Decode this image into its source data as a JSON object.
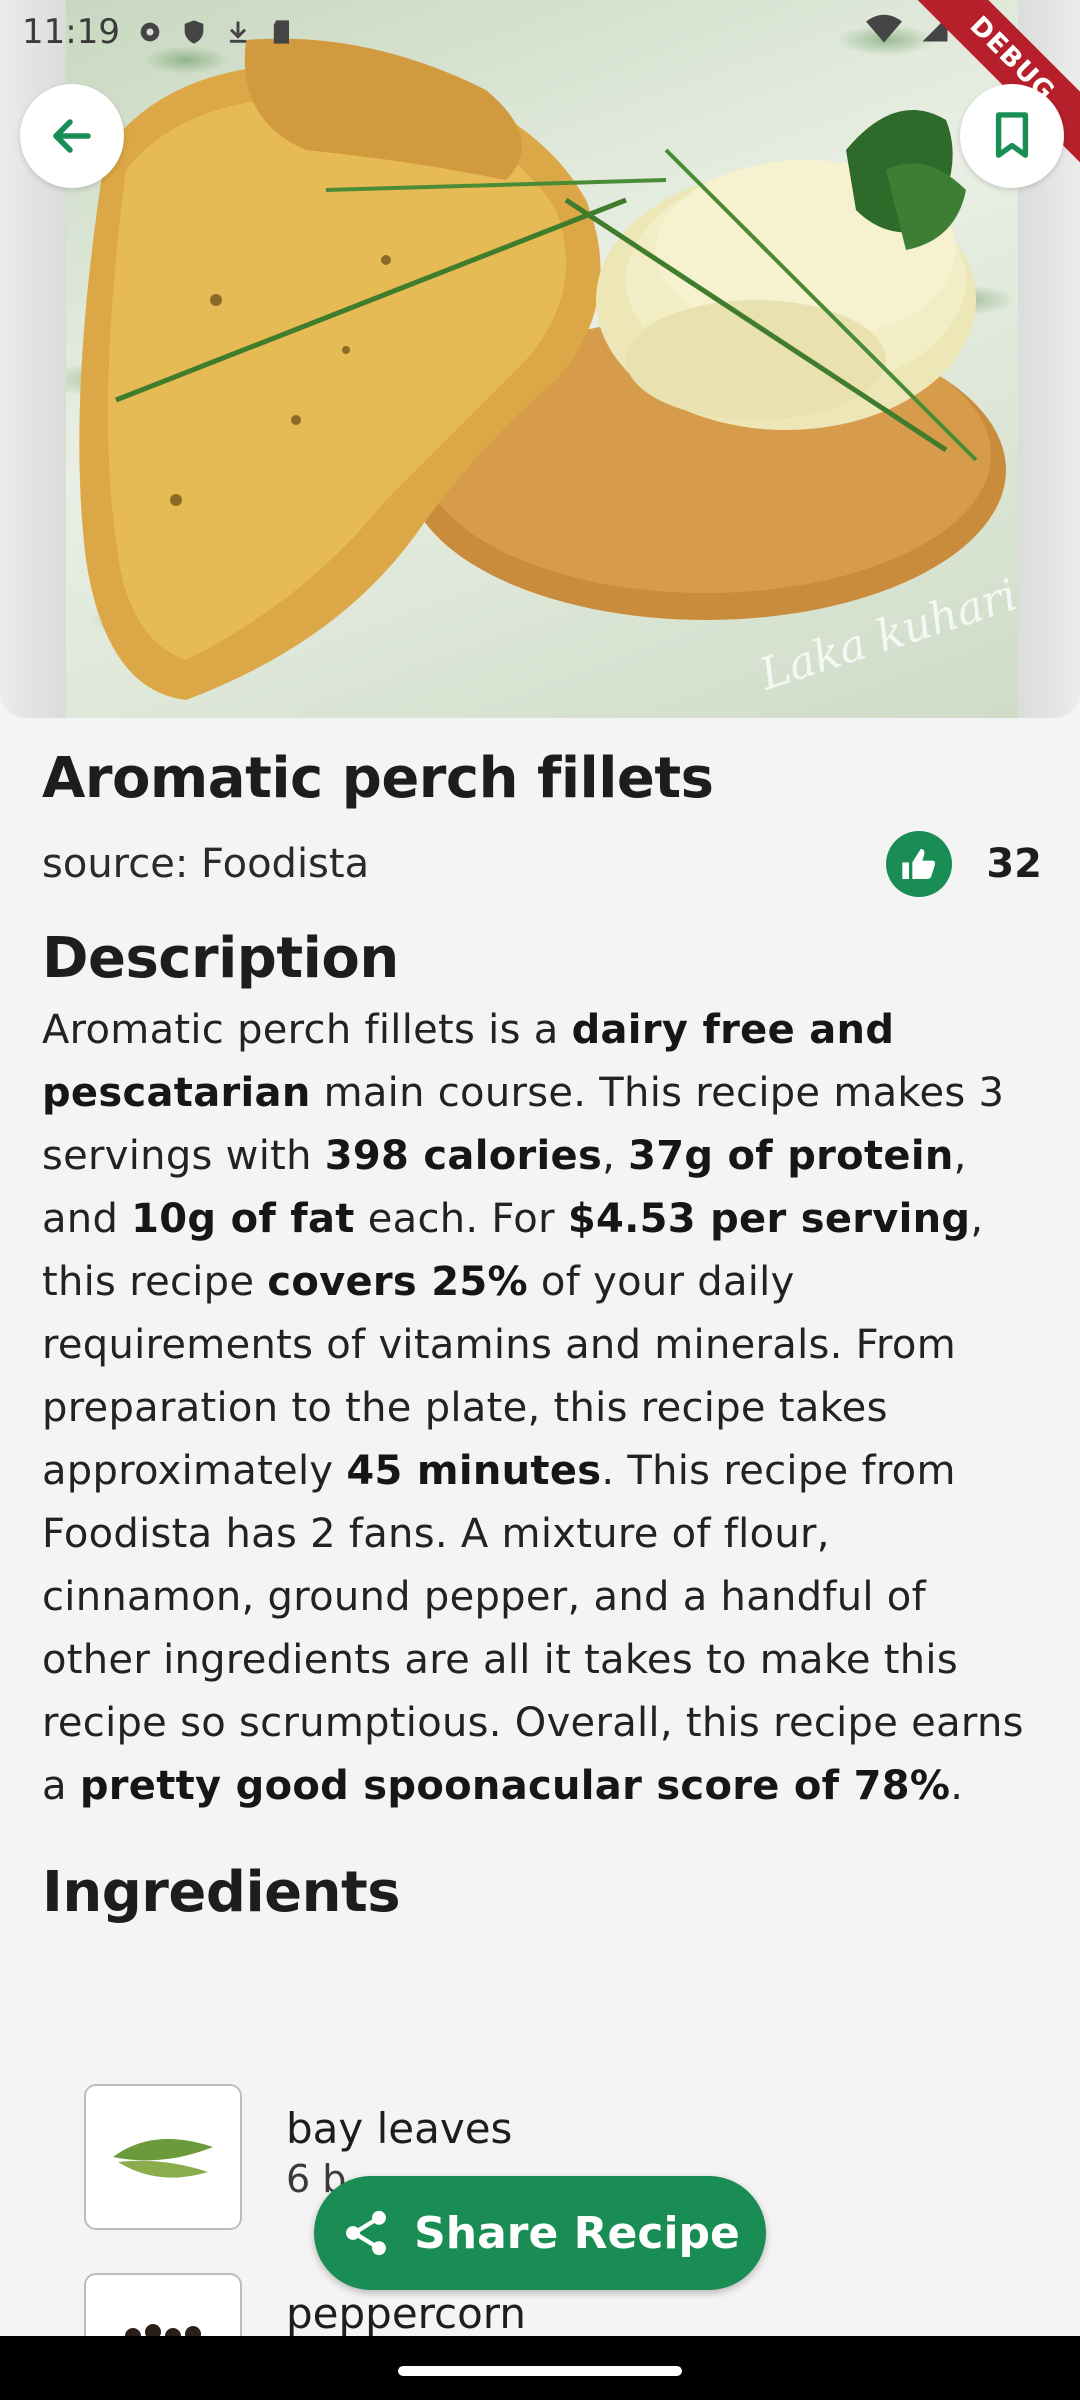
{
  "status_bar": {
    "time": "11:19"
  },
  "debug_banner": "DEBUG",
  "hero": {
    "watermark": "Laka kuharica"
  },
  "recipe": {
    "title": "Aromatic perch fillets",
    "source": "source: Foodista",
    "likes": "32"
  },
  "description": {
    "heading": "Description",
    "segments": [
      {
        "text": "Aromatic perch fillets is a ",
        "bold": false
      },
      {
        "text": "dairy free and pescatarian",
        "bold": true
      },
      {
        "text": " main course. This recipe makes 3 servings with ",
        "bold": false
      },
      {
        "text": "398 calories",
        "bold": true
      },
      {
        "text": ", ",
        "bold": false
      },
      {
        "text": "37g of protein",
        "bold": true
      },
      {
        "text": ", and ",
        "bold": false
      },
      {
        "text": "10g of fat",
        "bold": true
      },
      {
        "text": " each. For ",
        "bold": false
      },
      {
        "text": "$4.53 per serving",
        "bold": true
      },
      {
        "text": ", this recipe ",
        "bold": false
      },
      {
        "text": "covers 25%",
        "bold": true
      },
      {
        "text": " of your daily requirements of vitamins and minerals. From preparation to the plate, this recipe takes approximately ",
        "bold": false
      },
      {
        "text": "45 minutes",
        "bold": true
      },
      {
        "text": ". This recipe from Foodista has 2 fans. A mixture of flour, cinnamon, ground pepper, and a handful of other ingredients are all it takes to make this recipe so scrumptious. Overall, this recipe earns a ",
        "bold": false
      },
      {
        "text": "pretty good spoonacular score of 78%",
        "bold": true
      },
      {
        "text": ".",
        "bold": false
      }
    ]
  },
  "ingredients": {
    "heading": "Ingredients",
    "items": [
      {
        "name": "bay leaves",
        "amount": "6 b"
      },
      {
        "name": "peppercorn",
        "amount": ""
      }
    ]
  },
  "share_button": {
    "label": "Share Recipe"
  },
  "colors": {
    "accent": "#1a8d55",
    "background": "#f4f4f4",
    "debug": "#b5202b"
  },
  "icons": {
    "back": "arrow-left-icon",
    "bookmark": "bookmark-icon",
    "like": "thumbs-up-icon",
    "share": "share-icon"
  }
}
